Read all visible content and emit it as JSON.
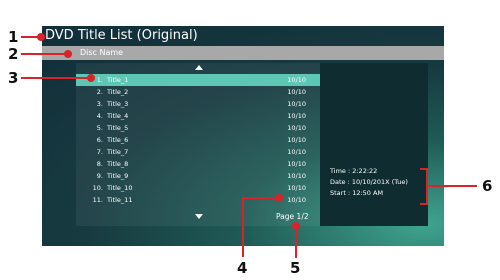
{
  "screen": {
    "title": "DVD Title List (Original)",
    "subheader": "Disc Name"
  },
  "titles": [
    {
      "num": "1.",
      "name": "Title_1",
      "count": "10/10",
      "selected": true
    },
    {
      "num": "2.",
      "name": "Title_2",
      "count": "10/10"
    },
    {
      "num": "3.",
      "name": "Title_3",
      "count": "10/10"
    },
    {
      "num": "4.",
      "name": "Title_4",
      "count": "10/10"
    },
    {
      "num": "5.",
      "name": "Title_5",
      "count": "10/10"
    },
    {
      "num": "6.",
      "name": "Title_6",
      "count": "10/10"
    },
    {
      "num": "7.",
      "name": "Title_7",
      "count": "10/10"
    },
    {
      "num": "8.",
      "name": "Title_8",
      "count": "10/10"
    },
    {
      "num": "9.",
      "name": "Title_9",
      "count": "10/10"
    },
    {
      "num": "10.",
      "name": "Title_10",
      "count": "10/10"
    },
    {
      "num": "11.",
      "name": "Title_11",
      "count": "10/10"
    }
  ],
  "page": "Page 1/2",
  "info": {
    "time": "Time : 2:22:22",
    "date": "Date : 10/10/201X (Tue)",
    "start": "Start : 12:50 AM"
  },
  "callouts": {
    "c1": "1",
    "c2": "2",
    "c3": "3",
    "c4": "4",
    "c5": "5",
    "c6": "6"
  },
  "colors": {
    "highlight": "#5ec6b4",
    "callout": "#d8232a",
    "subheader": "#a8a8a8"
  }
}
